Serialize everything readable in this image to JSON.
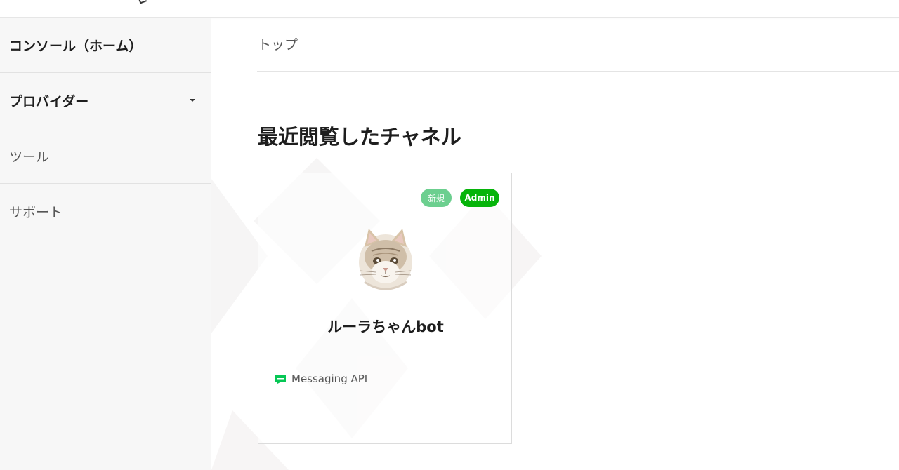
{
  "sidebar": {
    "items": [
      {
        "label": "コンソール（ホーム）"
      },
      {
        "label": "プロバイダー"
      },
      {
        "label": "ツール"
      },
      {
        "label": "サポート"
      }
    ]
  },
  "main": {
    "breadcrumb": "トップ",
    "section_title": "最近閲覧したチャネル",
    "channel_card": {
      "badges": [
        "新規",
        "Admin"
      ],
      "avatar_icon": "cat-avatar",
      "name": "ルーラちゃんbot",
      "type_icon": "messaging-api-icon",
      "type": "Messaging API"
    }
  },
  "colors": {
    "admin_badge": "#06b40a",
    "new_badge": "#6ccf8f",
    "sidebar_bg": "#f7f7f7",
    "messaging_icon": "#06c755"
  }
}
